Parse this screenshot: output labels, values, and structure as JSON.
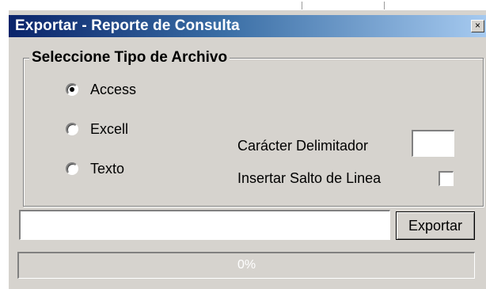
{
  "window": {
    "title": "Exportar - Reporte de Consulta",
    "close_glyph": "×"
  },
  "file_type_group": {
    "legend": "Seleccione Tipo de Archivo",
    "options": [
      {
        "label": "Access",
        "selected": true
      },
      {
        "label": "Excell",
        "selected": false
      },
      {
        "label": "Texto",
        "selected": false
      }
    ]
  },
  "delimiter": {
    "label": "Carácter Delimitador",
    "value": ""
  },
  "line_break": {
    "label": "Insertar Salto de Linea",
    "checked": false
  },
  "path_input": {
    "value": ""
  },
  "export_button": {
    "label": "Exportar"
  },
  "progress": {
    "text": "0%",
    "fraction": 0
  },
  "colors": {
    "titlebar_start": "#0a246a",
    "titlebar_end": "#a6caf0",
    "window_face": "#d6d3ce"
  }
}
